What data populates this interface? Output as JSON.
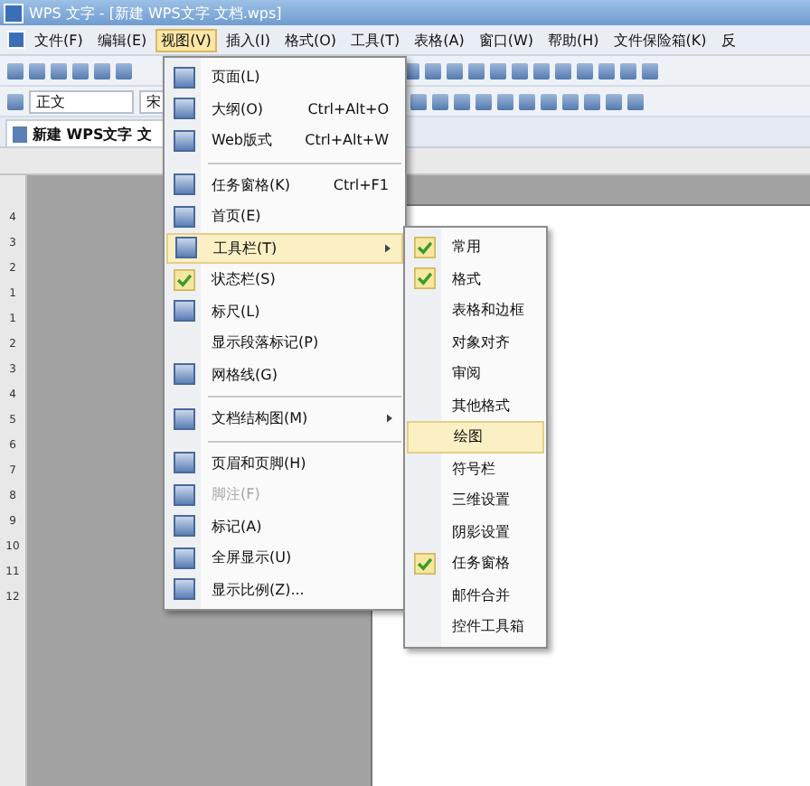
{
  "window": {
    "title": "WPS 文字 - [新建 WPS文字 文档.wps]"
  },
  "menu_bar": [
    {
      "label": "文件(F)",
      "selected": false
    },
    {
      "label": "编辑(E)",
      "selected": false
    },
    {
      "label": "视图(V)",
      "selected": true
    },
    {
      "label": "插入(I)",
      "selected": false
    },
    {
      "label": "格式(O)",
      "selected": false
    },
    {
      "label": "工具(T)",
      "selected": false
    },
    {
      "label": "表格(A)",
      "selected": false
    },
    {
      "label": "窗口(W)",
      "selected": false
    },
    {
      "label": "帮助(H)",
      "selected": false
    },
    {
      "label": "文件保险箱(K)",
      "selected": false
    },
    {
      "label": "反",
      "selected": false
    }
  ],
  "format_bar": {
    "style": "正文",
    "font": "宋"
  },
  "document_tab": {
    "label": "新建 WPS文字 文"
  },
  "vertical_ruler": [
    "4",
    "3",
    "2",
    "1",
    "1",
    "2",
    "3",
    "4",
    "5",
    "6",
    "7",
    "8",
    "9",
    "10",
    "11",
    "12"
  ],
  "view_menu": [
    {
      "kind": "item",
      "label": "页面(L)",
      "icon": true,
      "checked": false,
      "selected": false,
      "disabled": false,
      "submenu": false
    },
    {
      "kind": "item",
      "label": "大纲(O)",
      "shortcut": "Ctrl+Alt+O",
      "icon": true,
      "checked": false,
      "selected": false,
      "disabled": false,
      "submenu": false
    },
    {
      "kind": "item",
      "label": "Web版式",
      "shortcut": "Ctrl+Alt+W",
      "icon": true,
      "checked": false,
      "selected": false,
      "disabled": false,
      "submenu": false
    },
    {
      "kind": "separator"
    },
    {
      "kind": "item",
      "label": "任务窗格(K)",
      "shortcut": "Ctrl+F1",
      "icon": true,
      "checked": false,
      "selected": false,
      "disabled": false,
      "submenu": false
    },
    {
      "kind": "item",
      "label": "首页(E)",
      "icon": true,
      "checked": false,
      "selected": false,
      "disabled": false,
      "submenu": false
    },
    {
      "kind": "item",
      "label": "工具栏(T)",
      "icon": true,
      "checked": false,
      "selected": true,
      "disabled": false,
      "submenu": true
    },
    {
      "kind": "item",
      "label": "状态栏(S)",
      "icon": false,
      "checked": true,
      "selected": false,
      "disabled": false,
      "submenu": false
    },
    {
      "kind": "item",
      "label": "标尺(L)",
      "icon": true,
      "checked": false,
      "selected": false,
      "disabled": false,
      "submenu": false
    },
    {
      "kind": "item",
      "label": "显示段落标记(P)",
      "icon": false,
      "checked": false,
      "selected": false,
      "disabled": false,
      "submenu": false
    },
    {
      "kind": "item",
      "label": "网格线(G)",
      "icon": true,
      "checked": false,
      "selected": false,
      "disabled": false,
      "submenu": false
    },
    {
      "kind": "separator"
    },
    {
      "kind": "item",
      "label": "文档结构图(M)",
      "icon": true,
      "checked": false,
      "selected": false,
      "disabled": false,
      "submenu": true
    },
    {
      "kind": "separator"
    },
    {
      "kind": "item",
      "label": "页眉和页脚(H)",
      "icon": true,
      "checked": false,
      "selected": false,
      "disabled": false,
      "submenu": false
    },
    {
      "kind": "item",
      "label": "脚注(F)",
      "icon": true,
      "checked": false,
      "selected": false,
      "disabled": true,
      "submenu": false
    },
    {
      "kind": "item",
      "label": "标记(A)",
      "icon": true,
      "checked": false,
      "selected": false,
      "disabled": false,
      "submenu": false
    },
    {
      "kind": "item",
      "label": "全屏显示(U)",
      "icon": true,
      "checked": false,
      "selected": false,
      "disabled": false,
      "submenu": false
    },
    {
      "kind": "item",
      "label": "显示比例(Z)...",
      "icon": true,
      "checked": false,
      "selected": false,
      "disabled": false,
      "submenu": false
    }
  ],
  "toolbar_submenu": [
    {
      "label": "常用",
      "checked": true,
      "selected": false
    },
    {
      "label": "格式",
      "checked": true,
      "selected": false
    },
    {
      "label": "表格和边框",
      "checked": false,
      "selected": false
    },
    {
      "label": "对象对齐",
      "checked": false,
      "selected": false
    },
    {
      "label": "审阅",
      "checked": false,
      "selected": false
    },
    {
      "label": "其他格式",
      "checked": false,
      "selected": false
    },
    {
      "label": "绘图",
      "checked": false,
      "selected": true
    },
    {
      "label": "符号栏",
      "checked": false,
      "selected": false
    },
    {
      "label": "三维设置",
      "checked": false,
      "selected": false
    },
    {
      "label": "阴影设置",
      "checked": false,
      "selected": false
    },
    {
      "label": "任务窗格",
      "checked": true,
      "selected": false
    },
    {
      "label": "邮件合并",
      "checked": false,
      "selected": false
    },
    {
      "label": "控件工具箱",
      "checked": false,
      "selected": false
    }
  ]
}
